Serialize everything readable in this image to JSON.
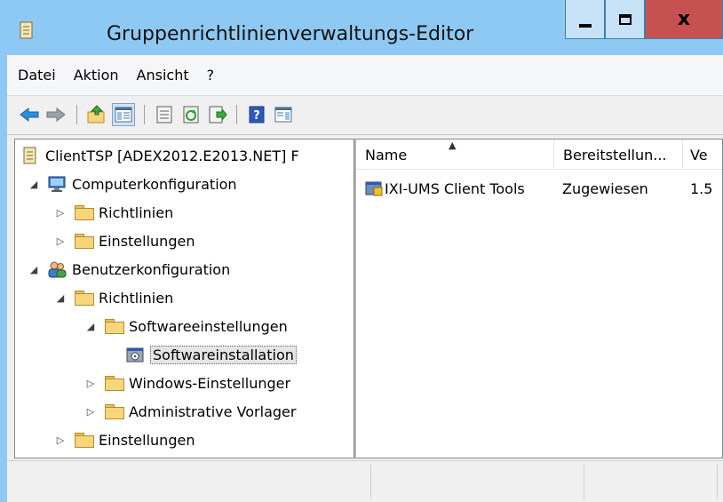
{
  "window": {
    "title": "Gruppenrichtlinienverwaltungs-Editor",
    "controls": {
      "minimize": "minimize-icon",
      "maximize": "maximize-icon",
      "close": "x"
    }
  },
  "menu": {
    "items": [
      {
        "label": "Datei"
      },
      {
        "label": "Aktion"
      },
      {
        "label": "Ansicht"
      },
      {
        "label": "?"
      }
    ]
  },
  "toolbar": {
    "buttons": [
      "back-arrow-icon",
      "forward-arrow-icon",
      "up-folder-icon",
      "show-hide-tree-icon",
      "properties-icon",
      "refresh-icon",
      "export-list-icon",
      "help-icon",
      "show-hide-action-pane-icon"
    ],
    "pressed": "show-hide-tree-icon"
  },
  "tree": {
    "root": "ClientTSP [ADEX2012.E2013.NET] F",
    "computer": {
      "label": "Computerkonfiguration",
      "children": [
        {
          "label": "Richtlinien"
        },
        {
          "label": "Einstellungen"
        }
      ]
    },
    "user": {
      "label": "Benutzerkonfiguration",
      "policies": "Richtlinien",
      "software_settings": "Softwareeinstellungen",
      "software_installation": "Softwareinstallation",
      "windows_settings": "Windows-Einstellunger",
      "admin_templates": "Administrative Vorlager",
      "preferences": "Einstellungen"
    },
    "selected": "Softwareinstallation"
  },
  "list": {
    "columns": [
      {
        "label": "Name"
      },
      {
        "label": "Bereitstellun..."
      },
      {
        "label": "Ve"
      }
    ],
    "sort_column": "Name",
    "rows": [
      {
        "name": "IXI-UMS Client Tools",
        "deployment": "Zugewiesen",
        "version": "1.5"
      }
    ]
  },
  "colors": {
    "titlebar": "#8ec9f3",
    "close_button": "#c75050",
    "selection": "#e5e5e5"
  }
}
